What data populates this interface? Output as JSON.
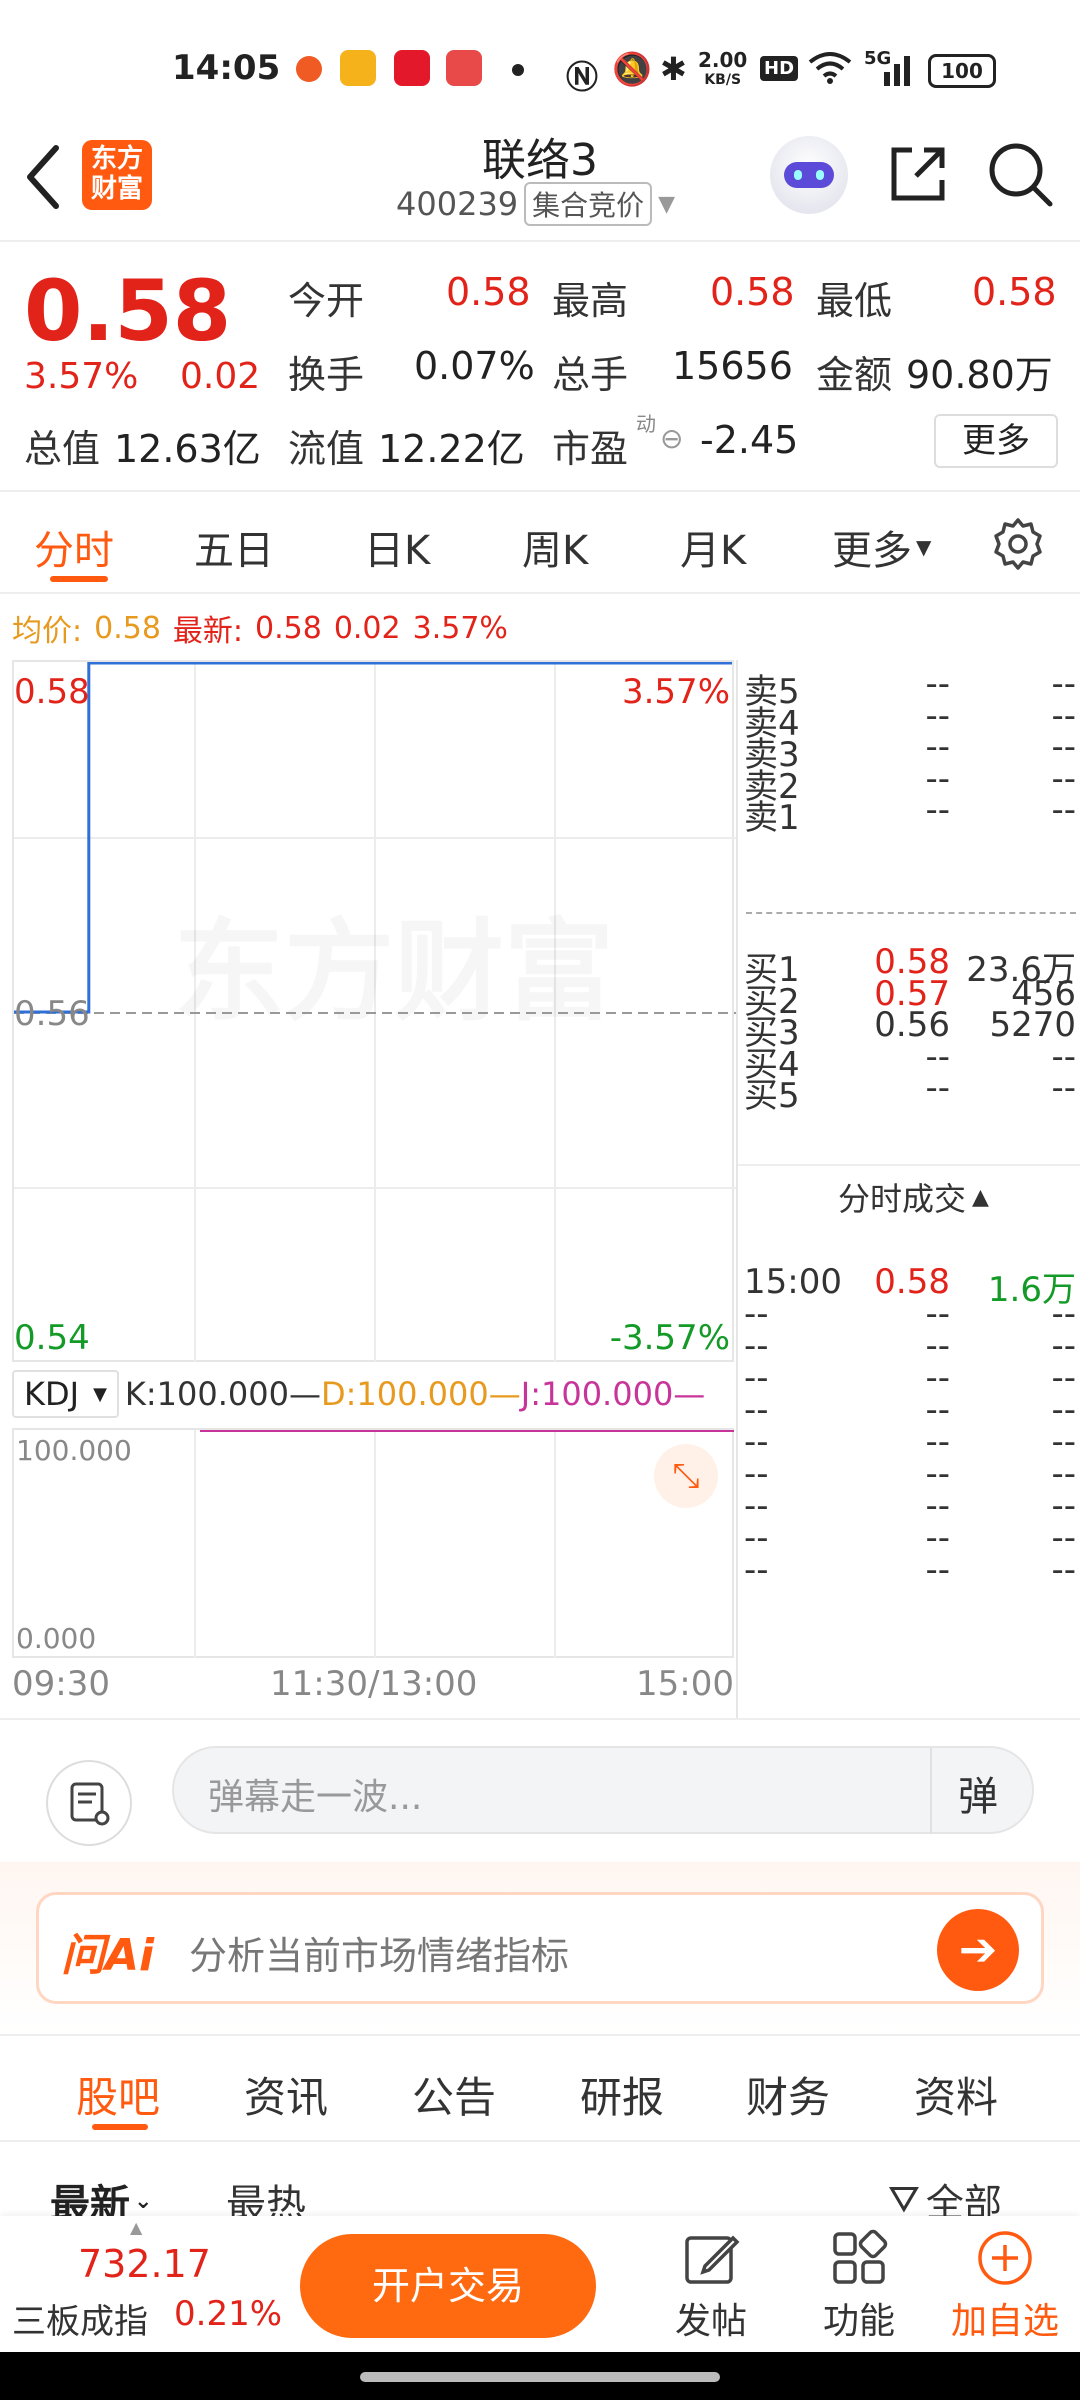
{
  "status_bar": {
    "time": "14:05",
    "net_speed_top": "2.00",
    "net_speed_unit": "KB/S",
    "hd": "HD",
    "signal": "5G",
    "battery": "100"
  },
  "header": {
    "brand_logo": "东方\n财富",
    "brand_l1": "东方",
    "brand_l2": "财富",
    "stock_name": "联络3",
    "stock_code": "400239",
    "auction_badge": "集合竞价"
  },
  "quote": {
    "price": "0.58",
    "change_pct": "3.57%",
    "change_amt": "0.02",
    "open_label": "今开",
    "open": "0.58",
    "high_label": "最高",
    "high": "0.58",
    "low_label": "最低",
    "low": "0.58",
    "turnover_label": "换手",
    "turnover": "0.07%",
    "volume_label": "总手",
    "volume": "15656",
    "amount_label": "金额",
    "amount": "90.80万",
    "mcap_label": "总值",
    "mcap": "12.63亿",
    "float_label": "流值",
    "float_cap": "12.22亿",
    "pe_label": "市盈",
    "pe_sup": "动",
    "pe": "-2.45",
    "more": "更多"
  },
  "tabs": {
    "items": [
      "分时",
      "五日",
      "日K",
      "周K",
      "月K",
      "更多"
    ],
    "active": 0
  },
  "chart_info": {
    "avg_label": "均价:",
    "avg": "0.58",
    "latest_label": "最新:",
    "latest": "0.58",
    "chg": "0.02",
    "pct": "3.57%"
  },
  "chart_data": {
    "type": "line",
    "x": [
      "09:30",
      "09:55",
      "09:55",
      "15:00"
    ],
    "series": [
      {
        "values": [
          0.56,
          0.56,
          0.58,
          0.58
        ]
      }
    ],
    "ylim": [
      0.54,
      0.58
    ],
    "y_ticks_left": [
      "0.58",
      "0.56",
      "0.54"
    ],
    "y_ticks_right": [
      "3.57%",
      "-3.57%"
    ],
    "x_ticks": [
      "09:30",
      "11:30/13:00",
      "15:00"
    ],
    "watermark": "东方财富"
  },
  "kdj": {
    "selector": "KDJ",
    "k": "K:100.000",
    "d": "D:100.000",
    "j": "J:100.000",
    "top": "100.000",
    "bottom": "0.000"
  },
  "order_book": {
    "sell": [
      {
        "label": "卖5",
        "price": "--",
        "vol": "--"
      },
      {
        "label": "卖4",
        "price": "--",
        "vol": "--"
      },
      {
        "label": "卖3",
        "price": "--",
        "vol": "--"
      },
      {
        "label": "卖2",
        "price": "--",
        "vol": "--"
      },
      {
        "label": "卖1",
        "price": "--",
        "vol": "--"
      }
    ],
    "buy": [
      {
        "label": "买1",
        "price": "0.58",
        "vol": "23.6万"
      },
      {
        "label": "买2",
        "price": "0.57",
        "vol": "456"
      },
      {
        "label": "买3",
        "price": "0.56",
        "vol": "5270"
      },
      {
        "label": "买4",
        "price": "--",
        "vol": "--"
      },
      {
        "label": "买5",
        "price": "--",
        "vol": "--"
      }
    ],
    "trades_title": "分时成交",
    "trades": [
      {
        "time": "15:00",
        "price": "0.58",
        "vol": "1.6万"
      },
      {
        "time": "--",
        "price": "--",
        "vol": "--"
      },
      {
        "time": "--",
        "price": "--",
        "vol": "--"
      },
      {
        "time": "--",
        "price": "--",
        "vol": "--"
      },
      {
        "time": "--",
        "price": "--",
        "vol": "--"
      },
      {
        "time": "--",
        "price": "--",
        "vol": "--"
      },
      {
        "time": "--",
        "price": "--",
        "vol": "--"
      },
      {
        "time": "--",
        "price": "--",
        "vol": "--"
      },
      {
        "time": "--",
        "price": "--",
        "vol": "--"
      },
      {
        "time": "--",
        "price": "--",
        "vol": "--"
      }
    ]
  },
  "danmu": {
    "placeholder": "弹幕走一波...",
    "toggle": "弹"
  },
  "ai": {
    "logo": "问Ai",
    "prompt": "分析当前市场情绪指标"
  },
  "sub_tabs": {
    "items": [
      "股吧",
      "资讯",
      "公告",
      "研报",
      "财务",
      "资料"
    ],
    "active": 0
  },
  "filter": {
    "latest": "最新",
    "hot": "最热",
    "all": "全部"
  },
  "bottom": {
    "index_value": "732.17",
    "index_name": "三板成指",
    "index_pct": "0.21%",
    "trade_btn": "开户交易",
    "post": "发帖",
    "function": "功能",
    "add_watch": "加自选"
  },
  "colors": {
    "up": "#e2231a",
    "down": "#149a27",
    "accent": "#ff6a00",
    "line": "#2f6fd6"
  }
}
